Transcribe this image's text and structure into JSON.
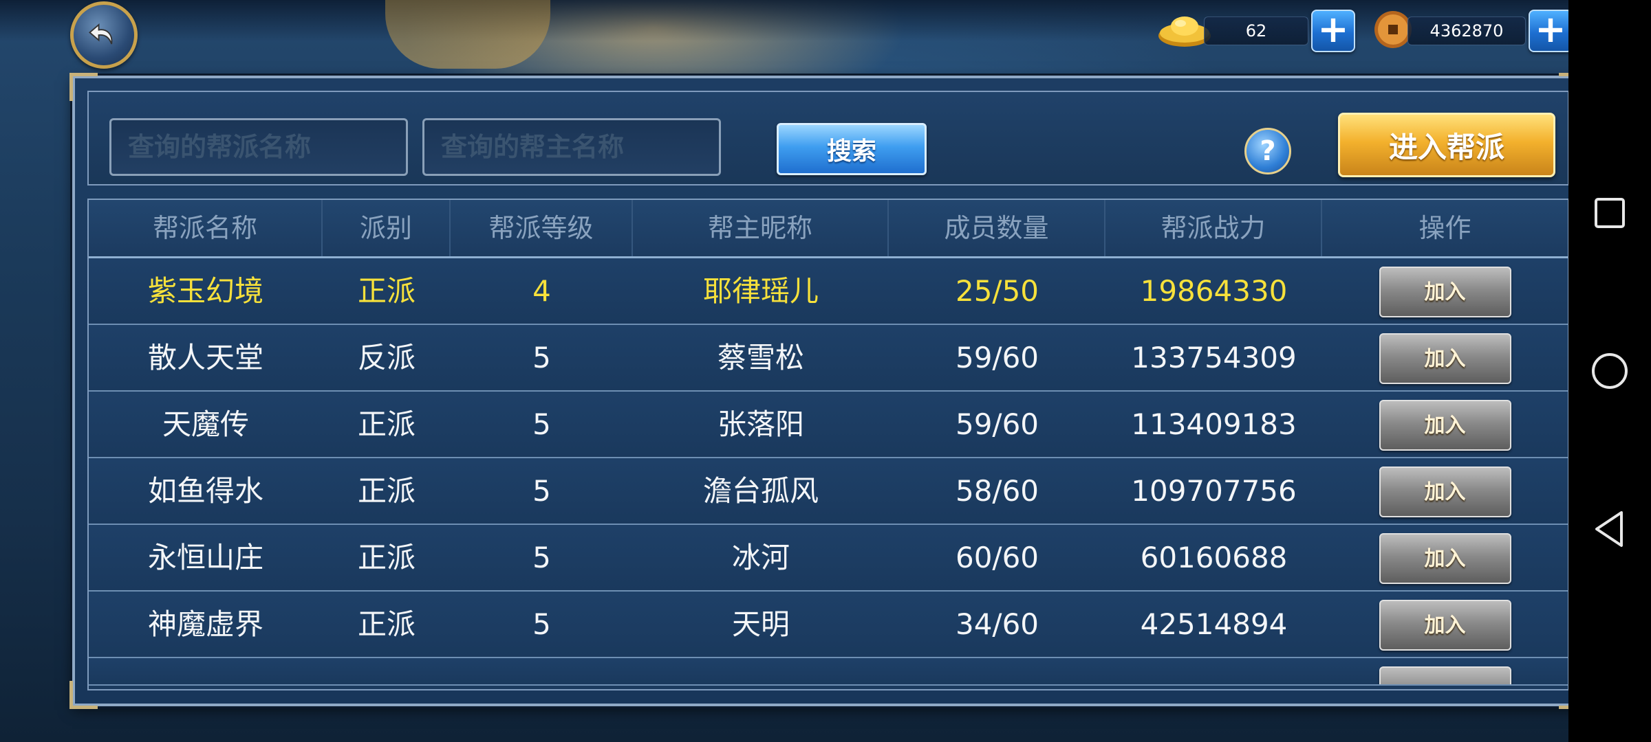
{
  "currency": {
    "gold": {
      "icon": "gold-ingot-icon",
      "value": "62"
    },
    "coins": {
      "icon": "copper-coin-icon",
      "value": "4362870"
    },
    "add_label": "+"
  },
  "search": {
    "guild_name_placeholder": "查询的帮派名称",
    "leader_name_placeholder": "查询的帮主名称",
    "search_label": "搜索",
    "help_label": "?",
    "enter_guild_label": "进入帮派"
  },
  "table": {
    "headers": [
      "帮派名称",
      "派别",
      "帮派等级",
      "帮主昵称",
      "成员数量",
      "帮派战力",
      "操作"
    ],
    "join_label": "加入",
    "rows": [
      {
        "name": "紫玉幻境",
        "faction": "正派",
        "level": "4",
        "leader": "耶律瑶儿",
        "members": "25/50",
        "power": "19864330",
        "highlight": true
      },
      {
        "name": "散人天堂",
        "faction": "反派",
        "level": "5",
        "leader": "蔡雪松",
        "members": "59/60",
        "power": "133754309"
      },
      {
        "name": "天魔传",
        "faction": "正派",
        "level": "5",
        "leader": "张落阳",
        "members": "59/60",
        "power": "113409183"
      },
      {
        "name": "如鱼得水",
        "faction": "正派",
        "level": "5",
        "leader": "澹台孤风",
        "members": "58/60",
        "power": "109707756"
      },
      {
        "name": "永恒山庄",
        "faction": "正派",
        "level": "5",
        "leader": "冰河",
        "members": "60/60",
        "power": "60160688"
      },
      {
        "name": "神魔虚界",
        "faction": "正派",
        "level": "5",
        "leader": "天明",
        "members": "34/60",
        "power": "42514894"
      }
    ]
  },
  "colors": {
    "highlight_text": "#f7e13b",
    "gold_button": "#f3b12d",
    "blue_button": "#3f9ef0",
    "panel_bg": "#1b3a5e"
  }
}
